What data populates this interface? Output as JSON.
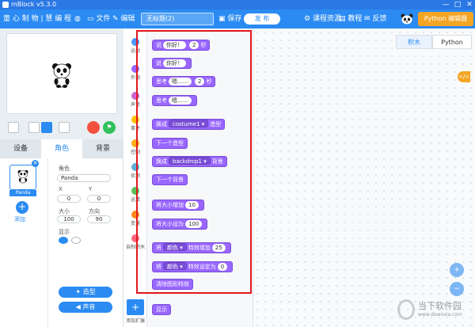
{
  "titlebar": {
    "title": "mBlock v5.3.0",
    "min": "—",
    "max": "□",
    "close": "✕"
  },
  "menubar": {
    "brand": "童 心 制 物 | 慧 编 程",
    "file": "文件",
    "edit": "编辑",
    "project_name": "无标题(2)",
    "save": "保存",
    "publish": "发 布",
    "courses": "课程资源",
    "tutorial": "教程",
    "feedback": "反馈",
    "python_editor": "Python 编辑器"
  },
  "stage_tabs": {
    "devices": "设备",
    "sprites": "角色",
    "backdrops": "背景"
  },
  "sprite": {
    "name": "Panda",
    "add_label": "添加",
    "role_label": "角色",
    "role_value": "Panda",
    "x_label": "X",
    "x_value": "0",
    "y_label": "Y",
    "y_value": "0",
    "size_label": "大小",
    "size_value": "100",
    "direction_label": "方向",
    "direction_value": "90",
    "show_label": "显示",
    "costume_button": "造型",
    "sound_button": "声音"
  },
  "categories": [
    {
      "label": "运动",
      "color": "#4c97ff"
    },
    {
      "label": "外观",
      "color": "#9966ff"
    },
    {
      "label": "声音",
      "color": "#cf63cf"
    },
    {
      "label": "事件",
      "color": "#ffbf00"
    },
    {
      "label": "控制",
      "color": "#ffab19"
    },
    {
      "label": "侦测",
      "color": "#5cb1d6"
    },
    {
      "label": "运算",
      "color": "#59c059"
    },
    {
      "label": "变量",
      "color": "#ff8c1a"
    },
    {
      "label": "自制积木",
      "color": "#ff6680"
    }
  ],
  "add_extension": "添加扩展",
  "blocks": {
    "say_for": {
      "pre": "说",
      "text": "你好！",
      "secs": "2",
      "post": "秒"
    },
    "say": {
      "pre": "说",
      "text": "你好！"
    },
    "think_for": {
      "pre": "思考",
      "text": "嗯……",
      "secs": "2",
      "post": "秒"
    },
    "think": {
      "pre": "思考",
      "text": "嗯……"
    },
    "switch_costume": {
      "pre": "换成",
      "dropdown": "costume1 ▾",
      "post": "造型"
    },
    "next_costume": "下一个造型",
    "switch_backdrop": {
      "pre": "换成",
      "dropdown": "backdrop1 ▾",
      "post": "背景"
    },
    "next_backdrop": "下一个背景",
    "change_size": {
      "pre": "将大小增加",
      "value": "10"
    },
    "set_size": {
      "pre": "将大小设为",
      "value": "100"
    },
    "change_effect": {
      "pre": "将",
      "dropdown": "颜色 ▾",
      "mid": "特效增加",
      "value": "25"
    },
    "set_effect": {
      "pre": "将",
      "dropdown": "颜色 ▾",
      "mid": "特效设定为",
      "value": "0"
    },
    "clear_effects": "清除图形特效",
    "show": "显示"
  },
  "workspace_tabs": {
    "blocks": "积木",
    "python": "Python"
  },
  "code_toggle": "</>",
  "watermark": {
    "title": "当下软件园",
    "url": "www.downxia.com"
  }
}
